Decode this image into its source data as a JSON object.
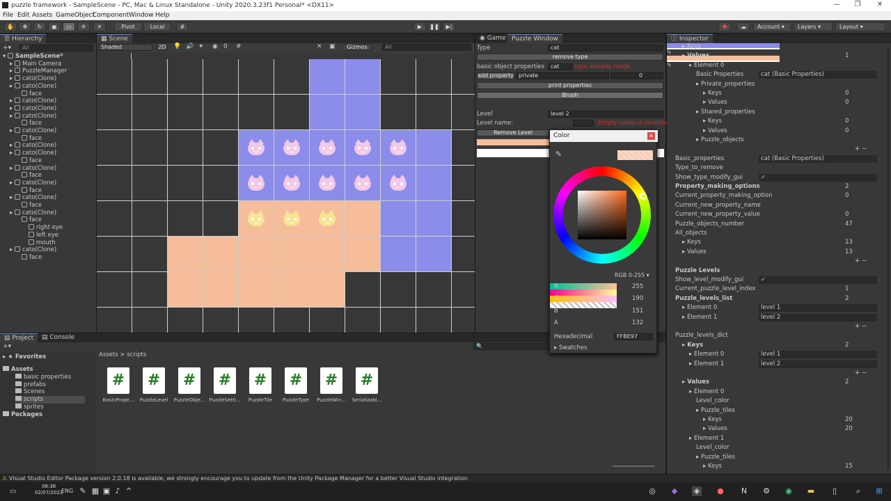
{
  "window": {
    "title": "puzzle framework - SampleScene - PC, Mac & Linux Standalone - Unity 2020.3.23f1 Personal* <DX11>"
  },
  "menu": [
    "File",
    "Edit",
    "Assets",
    "GameObject",
    "Component",
    "Window",
    "Help"
  ],
  "toolbar": {
    "pivot": "Pivot",
    "local": "Local",
    "account": "Account",
    "layers": "Layers",
    "layout": "Layout"
  },
  "hierarchy": {
    "tab": "Hierarchy",
    "search_placeholder": "All",
    "items": [
      {
        "label": "SampleScene*",
        "depth": 0
      },
      {
        "label": "Main Camera",
        "depth": 1
      },
      {
        "label": "PuzzleManager",
        "depth": 1
      },
      {
        "label": "cato(Clone)",
        "depth": 1
      },
      {
        "label": "cato(Clone)",
        "depth": 1
      },
      {
        "label": "face",
        "depth": 2
      },
      {
        "label": "cato(Clone)",
        "depth": 1
      },
      {
        "label": "cato(Clone)",
        "depth": 1
      },
      {
        "label": "cato(Clone)",
        "depth": 1
      },
      {
        "label": "face",
        "depth": 2
      },
      {
        "label": "cato(Clone)",
        "depth": 1
      },
      {
        "label": "face",
        "depth": 2
      },
      {
        "label": "cato(Clone)",
        "depth": 1
      },
      {
        "label": "cato(Clone)",
        "depth": 1
      },
      {
        "label": "face",
        "depth": 2
      },
      {
        "label": "cato(Clone)",
        "depth": 1
      },
      {
        "label": "face",
        "depth": 2
      },
      {
        "label": "cato(Clone)",
        "depth": 1
      },
      {
        "label": "face",
        "depth": 2
      },
      {
        "label": "cato(Clone)",
        "depth": 1
      },
      {
        "label": "face",
        "depth": 2
      },
      {
        "label": "cato(Clone)",
        "depth": 1
      },
      {
        "label": "face",
        "depth": 2
      },
      {
        "label": "right eye",
        "depth": 3
      },
      {
        "label": "left eye",
        "depth": 3
      },
      {
        "label": "mouth",
        "depth": 3
      },
      {
        "label": "cato(Clone)",
        "depth": 1
      },
      {
        "label": "face",
        "depth": 2
      }
    ]
  },
  "scene": {
    "tab": "Scene",
    "shading": "Shaded",
    "mode2d": "2D",
    "gizmos": "Gizmos",
    "search": "All",
    "layer_count": "0"
  },
  "puzzle_window": {
    "tabs": [
      "Game",
      "Puzzle Window"
    ],
    "type_label": "Type",
    "type_value": "cat",
    "remove_type": "remove type",
    "basic_props_label": "basic object properties",
    "basic_props_value": "cat",
    "basic_props_error": "type already made",
    "add_property": "add property",
    "add_property_mode": "private",
    "add_property_value": "0",
    "print_properties": "print properties",
    "brush": "Brush",
    "level_label": "Level",
    "level_value": "level 2",
    "level_name_label": "Level name:",
    "level_name_error": "Empty name is invalide",
    "remove_level": "Remove Level"
  },
  "color_picker": {
    "title": "Color",
    "mode": "RGB 0-255",
    "channels": [
      {
        "name": "R",
        "value": "255"
      },
      {
        "name": "G",
        "value": "190"
      },
      {
        "name": "B",
        "value": "151"
      },
      {
        "name": "A",
        "value": "132"
      }
    ],
    "hex_label": "Hexadecimal",
    "hex_value": "FFBE97",
    "swatches": "Swatches",
    "swatch_color": "#FFBE97"
  },
  "inspector": {
    "tab": "Inspector",
    "rows": [
      {
        "label": "Keys",
        "value": "",
        "indent": 1
      },
      {
        "label": "Values",
        "value": "1",
        "indent": 1,
        "bold": true
      },
      {
        "label": "Element 0",
        "value": "",
        "indent": 2
      },
      {
        "label": "Basic Properties",
        "value": "cat (Basic Properties)",
        "indent": 3
      },
      {
        "label": "Private_properties",
        "value": "",
        "indent": 3
      },
      {
        "label": "Keys",
        "value": "0",
        "indent": 4
      },
      {
        "label": "Values",
        "value": "0",
        "indent": 4
      },
      {
        "label": "Shared_properties",
        "value": "",
        "indent": 3
      },
      {
        "label": "Keys",
        "value": "0",
        "indent": 4
      },
      {
        "label": "Values",
        "value": "0",
        "indent": 4
      },
      {
        "label": "Puzzle_objects",
        "value": "",
        "indent": 3
      },
      {
        "label": "",
        "value": "",
        "indent": 0
      },
      {
        "label": "Basic_properties",
        "value": "cat (Basic Properties)",
        "indent": 0
      },
      {
        "label": "Type_to_remove",
        "value": "",
        "indent": 0
      },
      {
        "label": "Show_type_modify_gui",
        "value": "✓",
        "indent": 0
      },
      {
        "label": "Property_making_options",
        "value": "2",
        "indent": 0,
        "bold": true
      },
      {
        "label": "Current_property_making_option",
        "value": "0",
        "indent": 0
      },
      {
        "label": "Current_new_property_name",
        "value": "",
        "indent": 0
      },
      {
        "label": "Current_new_property_value",
        "value": "0",
        "indent": 0
      },
      {
        "label": "Puzzle_objects_number",
        "value": "47",
        "indent": 0
      },
      {
        "label": "All_objects",
        "value": "",
        "indent": 0
      },
      {
        "label": "Keys",
        "value": "13",
        "indent": 1
      },
      {
        "label": "Values",
        "value": "13",
        "indent": 1
      },
      {
        "label": "",
        "value": "",
        "indent": 0
      },
      {
        "label": "Puzzle Levels",
        "value": "",
        "indent": 0,
        "bold": true
      },
      {
        "label": "Show_level_modify_gui",
        "value": "✓",
        "indent": 0
      },
      {
        "label": "Current_puzzle_level_index",
        "value": "1",
        "indent": 0
      },
      {
        "label": "Puzzle_levels_list",
        "value": "2",
        "indent": 0,
        "bold": true
      },
      {
        "label": "Element 0",
        "value": "level 1",
        "indent": 1
      },
      {
        "label": "Element 1",
        "value": "level 2",
        "indent": 1
      },
      {
        "label": "",
        "value": "",
        "indent": 0
      },
      {
        "label": "Puzzle_levels_dict",
        "value": "",
        "indent": 0
      },
      {
        "label": "Keys",
        "value": "2",
        "indent": 1,
        "bold": true
      },
      {
        "label": "Element 0",
        "value": "level 1",
        "indent": 2
      },
      {
        "label": "Element 1",
        "value": "level 2",
        "indent": 2
      },
      {
        "label": "",
        "value": "",
        "indent": 0
      },
      {
        "label": "Values",
        "value": "2",
        "indent": 1,
        "bold": true
      },
      {
        "label": "Element 0",
        "value": "",
        "indent": 2
      },
      {
        "label": "Level_color",
        "value": "",
        "indent": 3,
        "color": "#8c8cea"
      },
      {
        "label": "Puzzle_tiles",
        "value": "",
        "indent": 3
      },
      {
        "label": "Keys",
        "value": "20",
        "indent": 4
      },
      {
        "label": "Values",
        "value": "20",
        "indent": 4
      },
      {
        "label": "Element 1",
        "value": "",
        "indent": 2
      },
      {
        "label": "Level_color",
        "value": "",
        "indent": 3,
        "color": "#f5bd9a"
      },
      {
        "label": "Puzzle_tiles",
        "value": "",
        "indent": 3
      },
      {
        "label": "Keys",
        "value": "15",
        "indent": 4
      }
    ]
  },
  "project": {
    "tabs": [
      "Project",
      "Console"
    ],
    "favorites": "Favorites",
    "tree": [
      {
        "label": "Assets",
        "depth": 0
      },
      {
        "label": "basic properties",
        "depth": 1
      },
      {
        "label": "prefabs",
        "depth": 1
      },
      {
        "label": "Scenes",
        "depth": 1
      },
      {
        "label": "scripts",
        "depth": 1
      },
      {
        "label": "sprites",
        "depth": 1
      },
      {
        "label": "Packages",
        "depth": 0
      }
    ],
    "breadcrumb": [
      "Assets",
      "scripts"
    ],
    "assets": [
      "BasicPrope...",
      "PuzzleLevel",
      "PuzzleObje...",
      "PuzzleSetti...",
      "PuzzleTile",
      "PuzzleType",
      "PuzzleWin...",
      "Serializabl..."
    ]
  },
  "status": {
    "message": "Visual Studio Editor Package version 2.0.18 is available, we strongly encourage you to update from the Unity Package Manager for a better Visual Studio integration"
  },
  "taskbar": {
    "time": "08:36",
    "date": "02/07/2023",
    "lang": "ENG"
  },
  "colors": {
    "blue_tile": "#8c8cea",
    "peach_tile": "#f5bd9a",
    "dark_tile": "#373737"
  },
  "grid": {
    "rows": 8,
    "cols": 11,
    "cells": [
      "DDDDDDBBDDD",
      "DDDDDDBBDDD",
      "DDDDBBBBBBD",
      "DDDDBBBBBBD",
      "DDDDPPPPBBD",
      "DDPPPPPPBBD",
      "DDPPPPPDDDD",
      "DDDDDDDDDDD"
    ],
    "cats": [
      {
        "r": 2,
        "c": 4,
        "k": "pink"
      },
      {
        "r": 2,
        "c": 5,
        "k": "pink"
      },
      {
        "r": 2,
        "c": 6,
        "k": "pink"
      },
      {
        "r": 2,
        "c": 7,
        "k": "pink"
      },
      {
        "r": 2,
        "c": 8,
        "k": "pink"
      },
      {
        "r": 3,
        "c": 4,
        "k": "pink"
      },
      {
        "r": 3,
        "c": 5,
        "k": "pink"
      },
      {
        "r": 3,
        "c": 6,
        "k": "pink"
      },
      {
        "r": 3,
        "c": 7,
        "k": "pink"
      },
      {
        "r": 3,
        "c": 8,
        "k": "pink"
      },
      {
        "r": 4,
        "c": 4,
        "k": "yellow"
      },
      {
        "r": 4,
        "c": 5,
        "k": "yellow"
      },
      {
        "r": 4,
        "c": 6,
        "k": "yellow"
      }
    ]
  }
}
